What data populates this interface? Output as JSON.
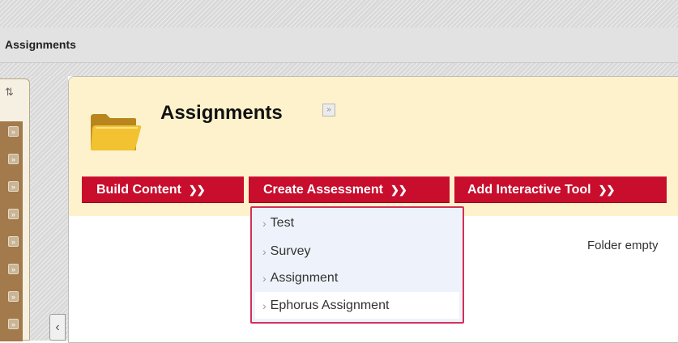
{
  "breadcrumb": {
    "current": "Assignments"
  },
  "page": {
    "title": "Assignments",
    "empty_message": "Folder empty"
  },
  "toolbar": {
    "build_content": "Build Content",
    "create_assessment": "Create Assessment",
    "add_interactive_tool": "Add Interactive Tool"
  },
  "assessment_menu": {
    "items": [
      {
        "label": "Test"
      },
      {
        "label": "Survey"
      },
      {
        "label": "Assignment"
      },
      {
        "label": "Ephorus Assignment",
        "highlighted": true
      }
    ]
  },
  "icons": {
    "folder": "folder-icon",
    "chevron": "double-chevron-down-icon",
    "reorder": "reorder-arrows-icon",
    "collapse": "chevron-left-icon"
  },
  "colors": {
    "button_red": "#c80d2d",
    "header_yellow": "#fdf2cc",
    "dropdown_border": "#d62f57",
    "menu_tab_brown": "#a27a4c"
  }
}
